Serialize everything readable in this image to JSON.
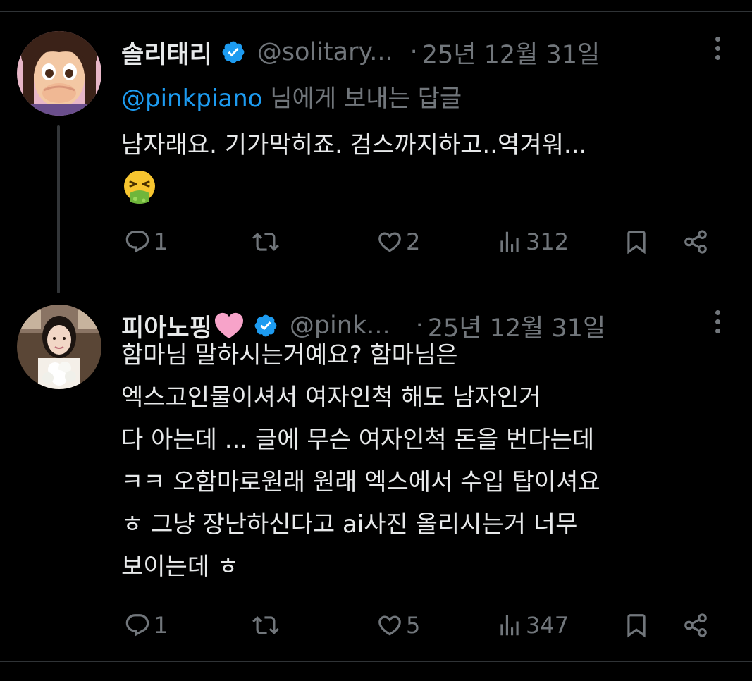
{
  "posts": [
    {
      "display_name": "솔리태리",
      "handle": "@solitary...",
      "separator": "·",
      "date": "25년 12월 31일",
      "reply_prefix": "@pinkpiano",
      "reply_suffix": " 님에게 보내는 답글",
      "text_lines": [
        "남자래요. 기가막히죠. 검스까지하고..역겨워..."
      ],
      "emoji": "face-vomiting-emoji",
      "replies": "1",
      "reposts": "",
      "likes": "2",
      "views": "312"
    },
    {
      "display_name": "피아노핑",
      "name_emoji": "pink-heart-emoji",
      "handle": "@pink...",
      "separator": "·",
      "date": "25년 12월 31일",
      "text_lines": [
        "함마님 말하시는거예요? 함마님은",
        "엑스고인물이셔서 여자인척 해도 남자인거",
        "다 아는데 ... 글에 무슨 여자인척 돈을 번다는데",
        "ㅋㅋ 오함마로원래 원래 엑스에서 수입 탑이셔요",
        "ㅎ 그냥 장난하신다고 ai사진 올리시는거 너무",
        "보이는데 ㅎ"
      ],
      "replies": "1",
      "reposts": "",
      "likes": "5",
      "views": "347"
    }
  ],
  "colors": {
    "background": "#000000",
    "text": "#e7e9ea",
    "muted": "#71767b",
    "link": "#1d9bf0",
    "verified": "#1d9bf0"
  }
}
